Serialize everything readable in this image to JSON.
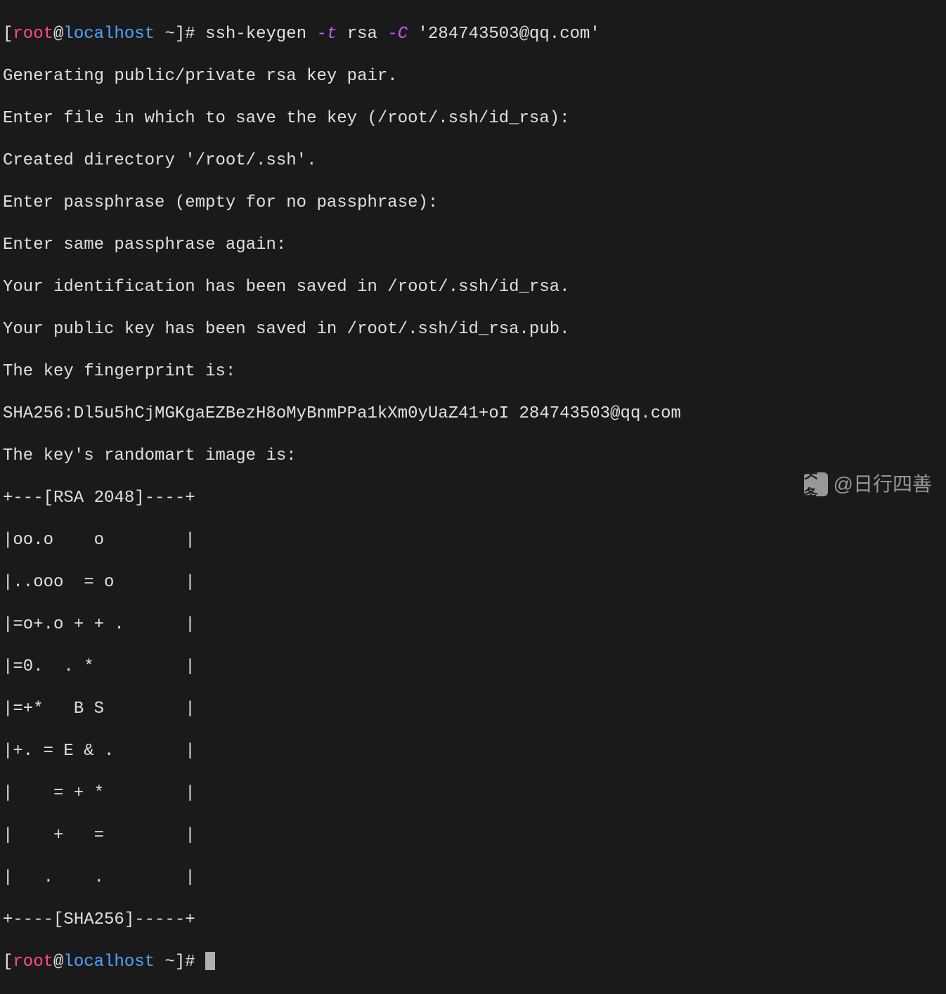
{
  "prompt1": {
    "open_bracket": "[",
    "user": "root",
    "at": "@",
    "host": "localhost",
    "path": " ~",
    "close_bracket_hash": "]# "
  },
  "command": {
    "cmd": "ssh-keygen ",
    "flag1": "-t",
    "arg1": " rsa ",
    "flag2": "-C",
    "arg2": " '284743503@qq.com'"
  },
  "output": {
    "l1": "Generating public/private rsa key pair.",
    "l2": "Enter file in which to save the key (/root/.ssh/id_rsa):",
    "l3": "Created directory '/root/.ssh'.",
    "l4": "Enter passphrase (empty for no passphrase):",
    "l5": "Enter same passphrase again:",
    "l6": "Your identification has been saved in /root/.ssh/id_rsa.",
    "l7": "Your public key has been saved in /root/.ssh/id_rsa.pub.",
    "l8": "The key fingerprint is:",
    "l9": "SHA256:Dl5u5hCjMGKgaEZBezH8oMyBnmPPa1kXm0yUaZ41+oI 284743503@qq.com",
    "l10": "The key's randomart image is:",
    "r1": "+---[RSA 2048]----+",
    "r2": "|oo.o    o        |",
    "r3": "|..ooo  = o       |",
    "r4": "|=o+.o + + .      |",
    "r5": "|=0.  . *         |",
    "r6": "|=+*   B S        |",
    "r7": "|+. = E & .       |",
    "r8": "|    = + *        |",
    "r9": "|    +   =        |",
    "r10": "|   .    .        |",
    "r11": "+----[SHA256]-----+"
  },
  "prompt2": {
    "open_bracket": "[",
    "user": "root",
    "at": "@",
    "host": "localhost",
    "path": " ~",
    "close_bracket_hash": "]# "
  },
  "watermark": {
    "logo": "头条",
    "text": "@日行四善"
  }
}
